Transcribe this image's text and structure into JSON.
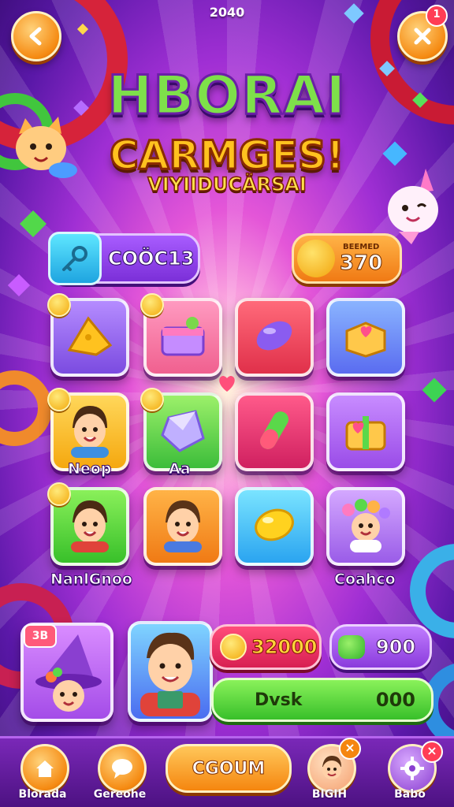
{
  "top_bar": {
    "value": "2040",
    "notification_count": "1"
  },
  "title": {
    "line1": "HBORAI",
    "line2": "CARMGES!",
    "line3": "VIYIIDUCÄRSAI"
  },
  "code_pill": {
    "text": "COÖC13"
  },
  "score_pill": {
    "label": "BEEMED",
    "value": "370"
  },
  "grid": {
    "tiles": [
      {
        "icon": "cheese-icon",
        "has_coin": true,
        "label": ""
      },
      {
        "icon": "gift-box-icon",
        "has_coin": true,
        "label": ""
      },
      {
        "icon": "jelly-bean-icon",
        "has_coin": false,
        "label": ""
      },
      {
        "icon": "heart-box-icon",
        "has_coin": false,
        "label": ""
      },
      {
        "icon": "boy-avatar-icon",
        "has_coin": true,
        "label": "Neop"
      },
      {
        "icon": "crystal-gem-icon",
        "has_coin": true,
        "label": "Aa"
      },
      {
        "icon": "capsule-icon",
        "has_coin": false,
        "label": ""
      },
      {
        "icon": "heart-gift-icon",
        "has_coin": false,
        "label": ""
      },
      {
        "icon": "kid-avatar-icon",
        "has_coin": true,
        "label": "NanlGnoo"
      },
      {
        "icon": "girl-avatar-icon",
        "has_coin": false,
        "label": ""
      },
      {
        "icon": "lemon-candy-icon",
        "has_coin": false,
        "label": ""
      },
      {
        "icon": "flower-kid-icon",
        "has_coin": false,
        "label": "Coahco"
      }
    ]
  },
  "bottom_panel": {
    "wizard_badge": "3B",
    "coins_value": "32000",
    "gems_value": "900",
    "progress_label": "Dvsk",
    "progress_value": "000"
  },
  "nav": {
    "items": [
      {
        "label": "Blorada",
        "icon": "home-icon"
      },
      {
        "label": "Gereohe",
        "icon": "chat-icon"
      },
      {
        "label": "BIGIH",
        "icon": "profile-icon"
      },
      {
        "label": "Babo",
        "icon": "gear-icon"
      }
    ],
    "center_button": "CGOUM"
  },
  "colors": {
    "accent": "#f58a12",
    "bg_purple": "#7a28b8",
    "green": "#4cd23a"
  }
}
